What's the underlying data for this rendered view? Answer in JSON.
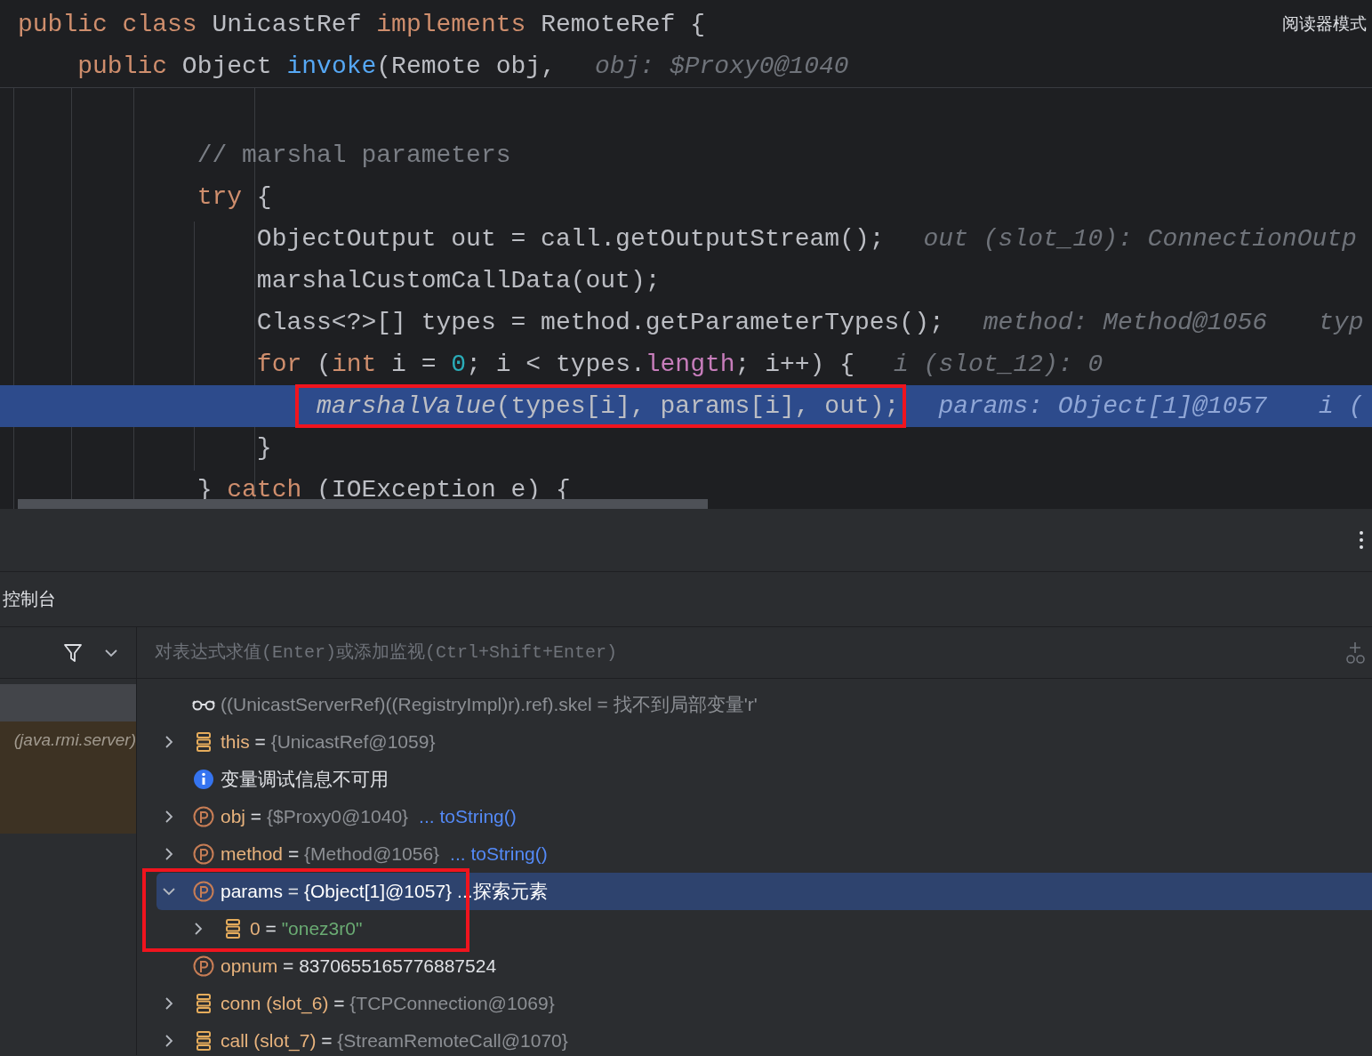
{
  "editor": {
    "reader_mode": "阅读器模式",
    "sticky_lines": [
      {
        "tokens": [
          {
            "t": "public class ",
            "kind": "kw"
          },
          {
            "t": "UnicastRef ",
            "kind": "plain"
          },
          {
            "t": "implements ",
            "kind": "kw"
          },
          {
            "t": "RemoteRef {",
            "kind": "plain"
          }
        ]
      },
      {
        "tokens": [
          {
            "t": "    public ",
            "kind": "kw"
          },
          {
            "t": "Object ",
            "kind": "plain"
          },
          {
            "t": "invoke",
            "kind": "fn"
          },
          {
            "t": "(Remote obj,",
            "kind": "plain"
          }
        ],
        "hints": [
          "obj: $Proxy0@1040"
        ]
      }
    ],
    "lines": [
      {
        "tokens": [
          {
            "t": "            // marshal parameters",
            "kind": "comment"
          }
        ],
        "current": false
      },
      {
        "tokens": [
          {
            "t": "            try",
            "kind": "kw"
          },
          {
            "t": " {",
            "kind": "plain"
          }
        ],
        "current": false
      },
      {
        "tokens": [
          {
            "t": "                ObjectOutput out = call.getOutputStream();",
            "kind": "plain"
          }
        ],
        "hints": [
          "out (slot_10): ConnectionOutp"
        ],
        "current": false
      },
      {
        "tokens": [
          {
            "t": "                marshalCustomCallData(out);",
            "kind": "plain"
          }
        ],
        "current": false
      },
      {
        "tokens": [
          {
            "t": "                Class<?>[] types = method.getParameterTypes();",
            "kind": "plain"
          }
        ],
        "hints": [
          "method: Method@1056",
          "typ"
        ],
        "current": false
      },
      {
        "tokens": [
          {
            "t": "                for",
            "kind": "kw"
          },
          {
            "t": " (",
            "kind": "plain"
          },
          {
            "t": "int",
            "kind": "kw"
          },
          {
            "t": " i = ",
            "kind": "plain"
          },
          {
            "t": "0",
            "kind": "num"
          },
          {
            "t": "; i < types.",
            "kind": "plain"
          },
          {
            "t": "length",
            "kind": "field"
          },
          {
            "t": "; i++) {",
            "kind": "plain"
          }
        ],
        "hints": [
          "i (slot_12): 0"
        ],
        "current": false
      },
      {
        "tokens": [
          {
            "t": "                    marshalValue",
            "kind": "static"
          },
          {
            "t": "(types[i], params[i], out);",
            "kind": "plain"
          }
        ],
        "hints": [
          "params: Object[1]@1057",
          "i ("
        ],
        "current": true,
        "red_box": true
      },
      {
        "tokens": [
          {
            "t": "                }",
            "kind": "plain"
          }
        ],
        "current": false
      },
      {
        "tokens": [
          {
            "t": "            } ",
            "kind": "plain"
          },
          {
            "t": "catch",
            "kind": "kw"
          },
          {
            "t": " (IOException e) {",
            "kind": "plain"
          }
        ],
        "current": false
      }
    ]
  },
  "debugger": {
    "console_tab": "控制台",
    "evaluate": {
      "placeholder": "对表达式求值(Enter)或添加监视(Ctrl+Shift+Enter)"
    },
    "frames": [
      {
        "selected": true,
        "kind": "normal"
      },
      {
        "label": "(java.rmi.server)",
        "selected": false,
        "kind": "library"
      }
    ],
    "variables": [
      {
        "kind": "watch",
        "name": "((UnicastServerRef)((RegistryImpl)r).ref).skel",
        "equals": "=",
        "value": {
          "text": "找不到局部变量'r'",
          "kind": "error"
        },
        "selected": false
      },
      {
        "kind": "field",
        "name": "this",
        "equals": "=",
        "value": {
          "text": "{UnicastRef@1059}",
          "kind": "ref"
        },
        "expanded": false,
        "selected": false
      },
      {
        "kind": "info",
        "name": "变量调试信息不可用",
        "selected": false
      },
      {
        "kind": "param",
        "name": "obj",
        "equals": "=",
        "value": {
          "text": "{$Proxy0@1040}",
          "kind": "ref"
        },
        "action": "... toString()",
        "expanded": false,
        "selected": false
      },
      {
        "kind": "param",
        "name": "method",
        "equals": "=",
        "value": {
          "text": "{Method@1056}",
          "kind": "ref"
        },
        "action": "... toString()",
        "expanded": false,
        "selected": false
      },
      {
        "kind": "param",
        "name": "params",
        "equals": "=",
        "value": {
          "text": "{Object[1]@1057}",
          "kind": "ref"
        },
        "action": "...探索元素",
        "expanded": true,
        "selected": true,
        "red_box": true,
        "children": [
          {
            "kind": "field",
            "name": "0",
            "equals": "=",
            "value": {
              "text": "\"onez3r0\"",
              "kind": "string"
            },
            "expanded": false,
            "selected": false
          }
        ]
      },
      {
        "kind": "param",
        "name": "opnum",
        "equals": "=",
        "value": {
          "text": "8370655165776887524",
          "kind": "number"
        },
        "selected": false
      },
      {
        "kind": "field",
        "name": "conn (slot_6)",
        "equals": "=",
        "value": {
          "text": "{TCPConnection@1069}",
          "kind": "ref"
        },
        "expanded": false,
        "selected": false
      },
      {
        "kind": "field",
        "name": "call (slot_7)",
        "equals": "=",
        "value": {
          "text": "{StreamRemoteCall@1070}",
          "kind": "ref"
        },
        "expanded": false,
        "selected": false
      }
    ]
  }
}
